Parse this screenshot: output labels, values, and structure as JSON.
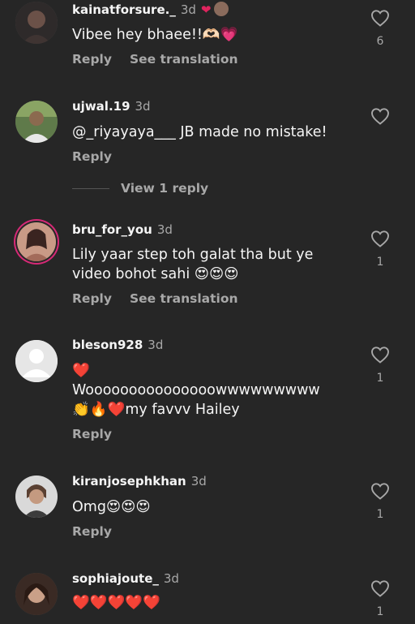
{
  "comments": [
    {
      "username": "kainatforsure._",
      "time": "3d",
      "text": "Vibee hey bhaee!!🫶🏻💗",
      "reply_label": "Reply",
      "translate_label": "See translation",
      "likes": "6"
    },
    {
      "username": "ujwal.19",
      "time": "3d",
      "text": "@_riyayaya___ JB made no mistake!",
      "reply_label": "Reply",
      "view_replies_label": "View 1 reply",
      "likes": ""
    },
    {
      "username": "bru_for_you",
      "time": "3d",
      "text": "Lily yaar step toh galat tha but ye video bohot sahi 😍😍😍",
      "reply_label": "Reply",
      "translate_label": "See translation",
      "likes": "1"
    },
    {
      "username": "bleson928",
      "time": "3d",
      "text_line1": "❤️",
      "text_line2": "Wooooooooooooooowwwwwwwww",
      "text_line3": "👏🔥❤️my favvv Hailey",
      "reply_label": "Reply",
      "likes": "1"
    },
    {
      "username": "kiranjosephkhan",
      "time": "3d",
      "text": "Omg😍😍😍",
      "reply_label": "Reply",
      "likes": "1"
    },
    {
      "username": "sophiajoute_",
      "time": "3d",
      "text": "❤️❤️❤️❤️❤️",
      "likes": "1"
    }
  ],
  "colors": {
    "background": "#262626",
    "text_primary": "#f5f5f5",
    "text_secondary": "#a8a8a8",
    "story_ring": "#d62976",
    "like_heart": "#e0245e"
  },
  "icons": {
    "like": "heart-outline-icon",
    "author_liked": "heart-icon"
  }
}
